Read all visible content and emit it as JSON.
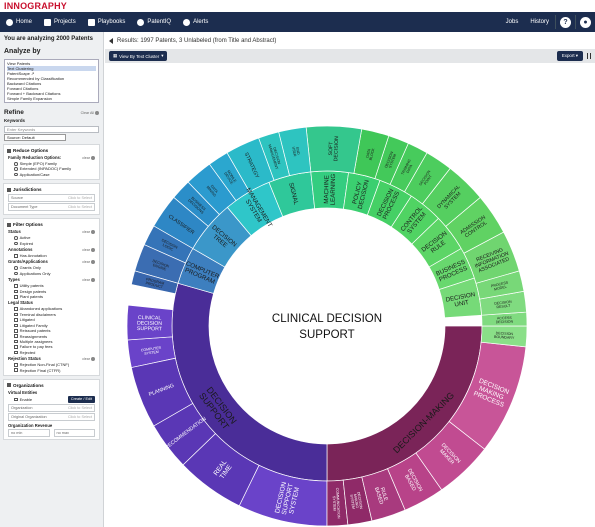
{
  "app": {
    "logo": "INNOGRAPHY"
  },
  "nav": {
    "left": [
      {
        "icon": "home-icon",
        "label": "Home"
      },
      {
        "icon": "folder-icon",
        "label": "Projects"
      },
      {
        "icon": "playbook-icon",
        "label": "Playbooks"
      },
      {
        "icon": "patentiq-icon",
        "label": "PatentIQ"
      },
      {
        "icon": "alert-icon",
        "label": "Alerts"
      }
    ],
    "jobs": "Jobs",
    "history": "History",
    "help": "?",
    "user_icon": "user-icon"
  },
  "sidebar": {
    "analyzing": "You are analyzing 2000 Patents",
    "analyze_by": "Analyze by",
    "analyze_options": [
      "View Patents",
      "Text Clustering",
      "PatentScape ↗",
      "Recommended by Classification",
      "Backward Citations",
      "Forward Citations",
      "Forward + Backward Citations",
      "Simple Family Expansion"
    ],
    "refine": "Refine",
    "clear_all": "Clear All",
    "keywords_label": "Keywords",
    "keywords_placeholder": "Enter Keywords",
    "source_value": "Source: Default",
    "reduce": {
      "title": "Reduce Options",
      "family_label": "Family Reduction Options:",
      "clear": "clear",
      "options": [
        "Simple (EPO) Family",
        "Extended (INPADOC) Family",
        "Application/Case"
      ]
    },
    "jurisdictions": {
      "title": "Jurisdictions",
      "source": "Source",
      "doc_type": "Document Type",
      "hint": "Click to Select"
    },
    "filter": {
      "title": "Filter Options",
      "status": {
        "label": "Status",
        "clear": "clear",
        "options": [
          "Active",
          "Expired"
        ]
      },
      "annotations": {
        "label": "Annotations",
        "clear": "clear",
        "options": [
          "Has Annotation"
        ]
      },
      "grants": {
        "label": "Grants/Applications",
        "clear": "clear",
        "options": [
          "Grants Only",
          "Applications Only"
        ]
      },
      "types": {
        "label": "Types",
        "clear": "clear",
        "options": [
          "Utility patents",
          "Design patents",
          "Plant patents"
        ]
      },
      "legal": {
        "label": "Legal Status",
        "options": [
          "Abandoned applications",
          "Terminal disclaimers",
          "Litigated",
          "Litigated Family",
          "Reissued patents",
          "Reassignments",
          "Multiple assignees",
          "Failure to pay fees",
          "Rejected"
        ]
      },
      "rejection": {
        "label": "Rejection Status",
        "clear": "clear",
        "options": [
          "Rejection Non-Final (CTNF)",
          "Rejection Final (CTFR)"
        ]
      }
    },
    "orgs": {
      "title": "Organizations",
      "virtual": "Virtual Entities",
      "enable": "Enable",
      "create": "Create / Edit",
      "org": "Organization",
      "orig_org": "Original Organization",
      "revenue": "Organization Revenue",
      "min": "no min",
      "max": "no max",
      "hint": "Click to Select"
    }
  },
  "main": {
    "results": "Results: 1997 Patents, 3 Unlabeled (from Title and Abstract)",
    "view_button": "View By Text Cluster",
    "export_button": "Export",
    "center_label": [
      "CLINICAL DECISION",
      "SUPPORT"
    ]
  },
  "colors": {
    "nav": "#1c2d4f",
    "logo": "#c8102e"
  },
  "chart_data": {
    "type": "sunburst",
    "center": "CLINICAL DECISION SUPPORT",
    "inner": [
      {
        "name": "DECISION-MAKING",
        "color": "#7a2458"
      },
      {
        "name": "DECISION SUPPORT",
        "color": "#4a2d98"
      },
      {
        "name": "COMPUTER PROGRAM",
        "color": "#3d7fbf"
      },
      {
        "name": "DECISION TREE",
        "color": "#3b97c9"
      },
      {
        "name": "MANAGEMENT SYSTEM",
        "color": "#2fc6c9"
      },
      {
        "name": "SIGNAL",
        "color": "#2fc89a"
      },
      {
        "name": "MACHINE LEARNING",
        "color": "#34cd80"
      },
      {
        "name": "POLICY DECISION",
        "color": "#3bcf70"
      },
      {
        "name": "DECISION PROCESS",
        "color": "#45d065"
      },
      {
        "name": "CONTROL SYSTEM",
        "color": "#50d363"
      },
      {
        "name": "DECISION RULE",
        "color": "#5cd566"
      },
      {
        "name": "BUSINESS PROCESS",
        "color": "#68d86e"
      },
      {
        "name": "DECISION UNIT",
        "color": "#76da78"
      }
    ],
    "outer": [
      "COMPUTER SYSTEM",
      "CLINICAL DECISION SUPPORT",
      "PLANNING",
      "RECOMMENDATION",
      "REAL TIME",
      "DECISION SUPPORT SYSTEM",
      "COMMUNICATION SYSTEM",
      "DECISION MAKING SYSTEM",
      "RULE BASED",
      "DECISION BASED",
      "DECISION MAKER",
      "DECISION MAKING PROCESS",
      "DECISION BOUNDARY",
      "ACCESS DECISION",
      "DECISION RESULT",
      "PROCESS MODEL",
      "RECEIVING INFORMATION ASSOCIATED",
      "ADMISSION CONTROL",
      "DYNAMICAL SYSTEM",
      "DECISION POINT",
      "TRAINING DATA",
      "DECISION SYSTEM",
      "DATA BLOCK",
      "SOFT DECISION",
      "END USER",
      "DECISION MANAGEMENT",
      "STRATEGY",
      "MOBILE DEVICE",
      "DATA MINING",
      "BUSINESS DECISIONS",
      "CLASSIFIER",
      "DECISION LOGIC",
      "DECISION ENGINE",
      "PROGRAM PRODUCT"
    ]
  }
}
